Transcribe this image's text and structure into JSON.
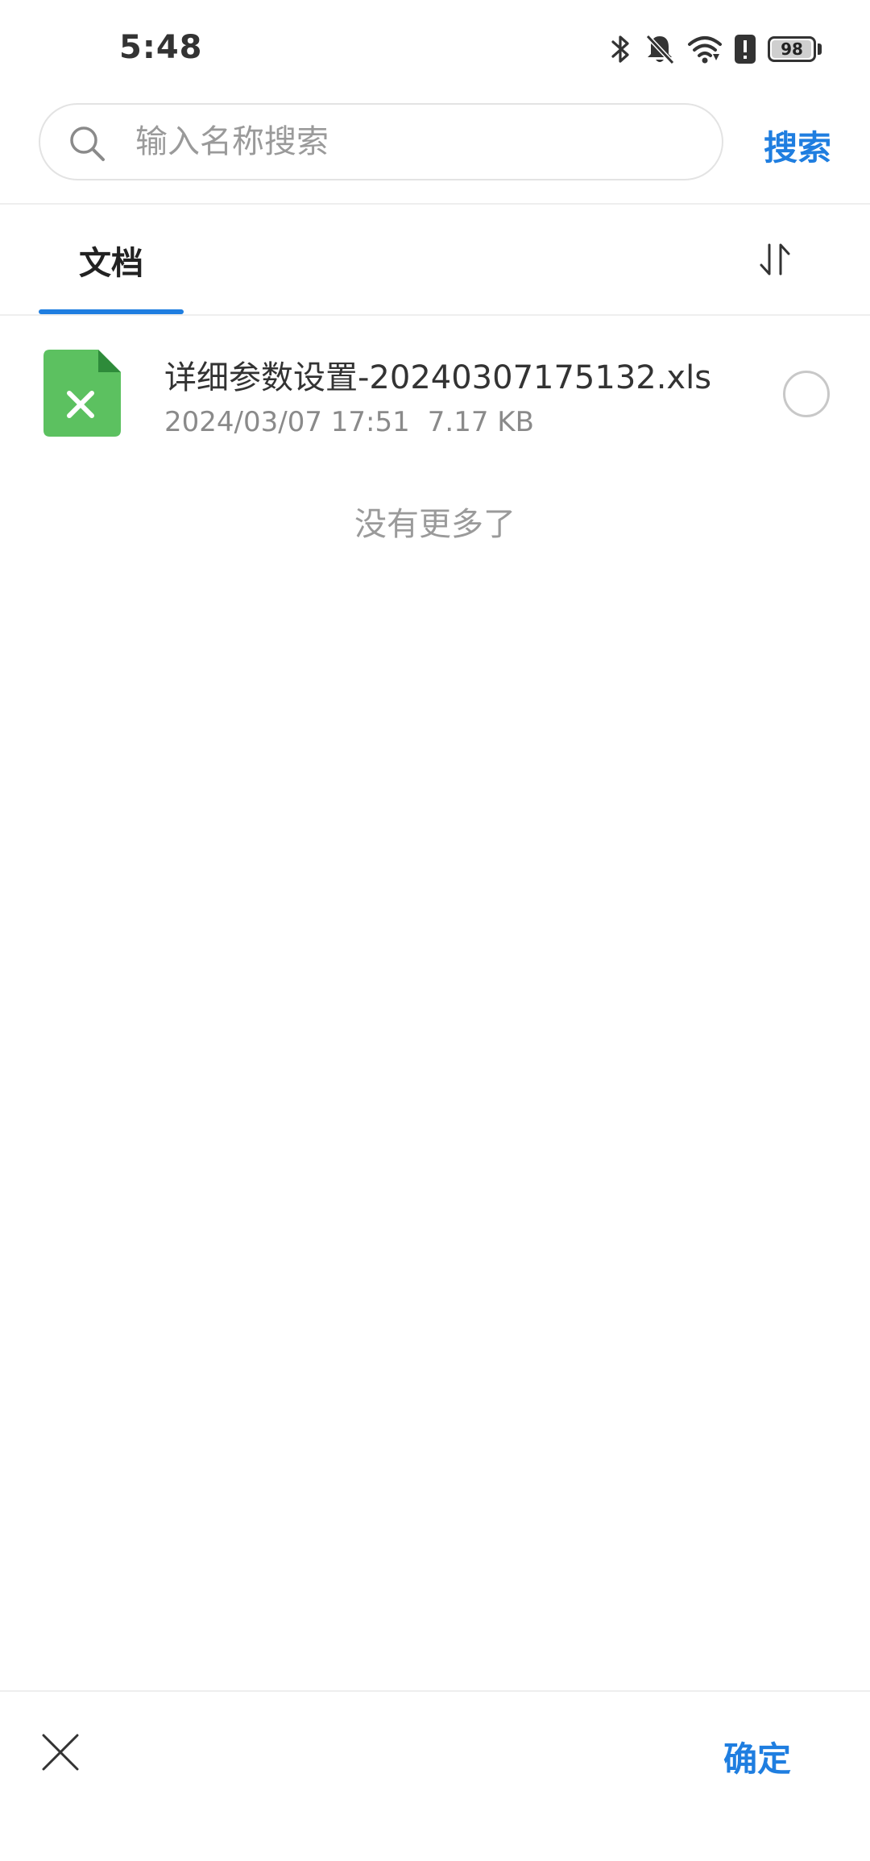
{
  "status_bar": {
    "time": "5:48",
    "battery_level": "98",
    "battery_fraction": 0.98,
    "icons": [
      "bluetooth-icon",
      "bell-off-icon",
      "wifi-icon",
      "alert-icon",
      "battery-icon"
    ]
  },
  "search": {
    "placeholder": "输入名称搜索",
    "value": "",
    "button_label": "搜索"
  },
  "tabs": [
    {
      "label": "文档",
      "active": true
    }
  ],
  "sort_icon": "sort-icon",
  "files": [
    {
      "name": "详细参数设置-20240307175132.xls",
      "date": "2024/03/07 17:51",
      "size": "7.17 KB",
      "icon": "excel-file-icon",
      "icon_color": "#5cc160",
      "selected": false
    }
  ],
  "list_end_text": "没有更多了",
  "bottom_bar": {
    "close_icon": "close-icon",
    "confirm_label": "确定"
  },
  "colors": {
    "accent": "#1f7ee0",
    "excel_green": "#5cc160"
  }
}
